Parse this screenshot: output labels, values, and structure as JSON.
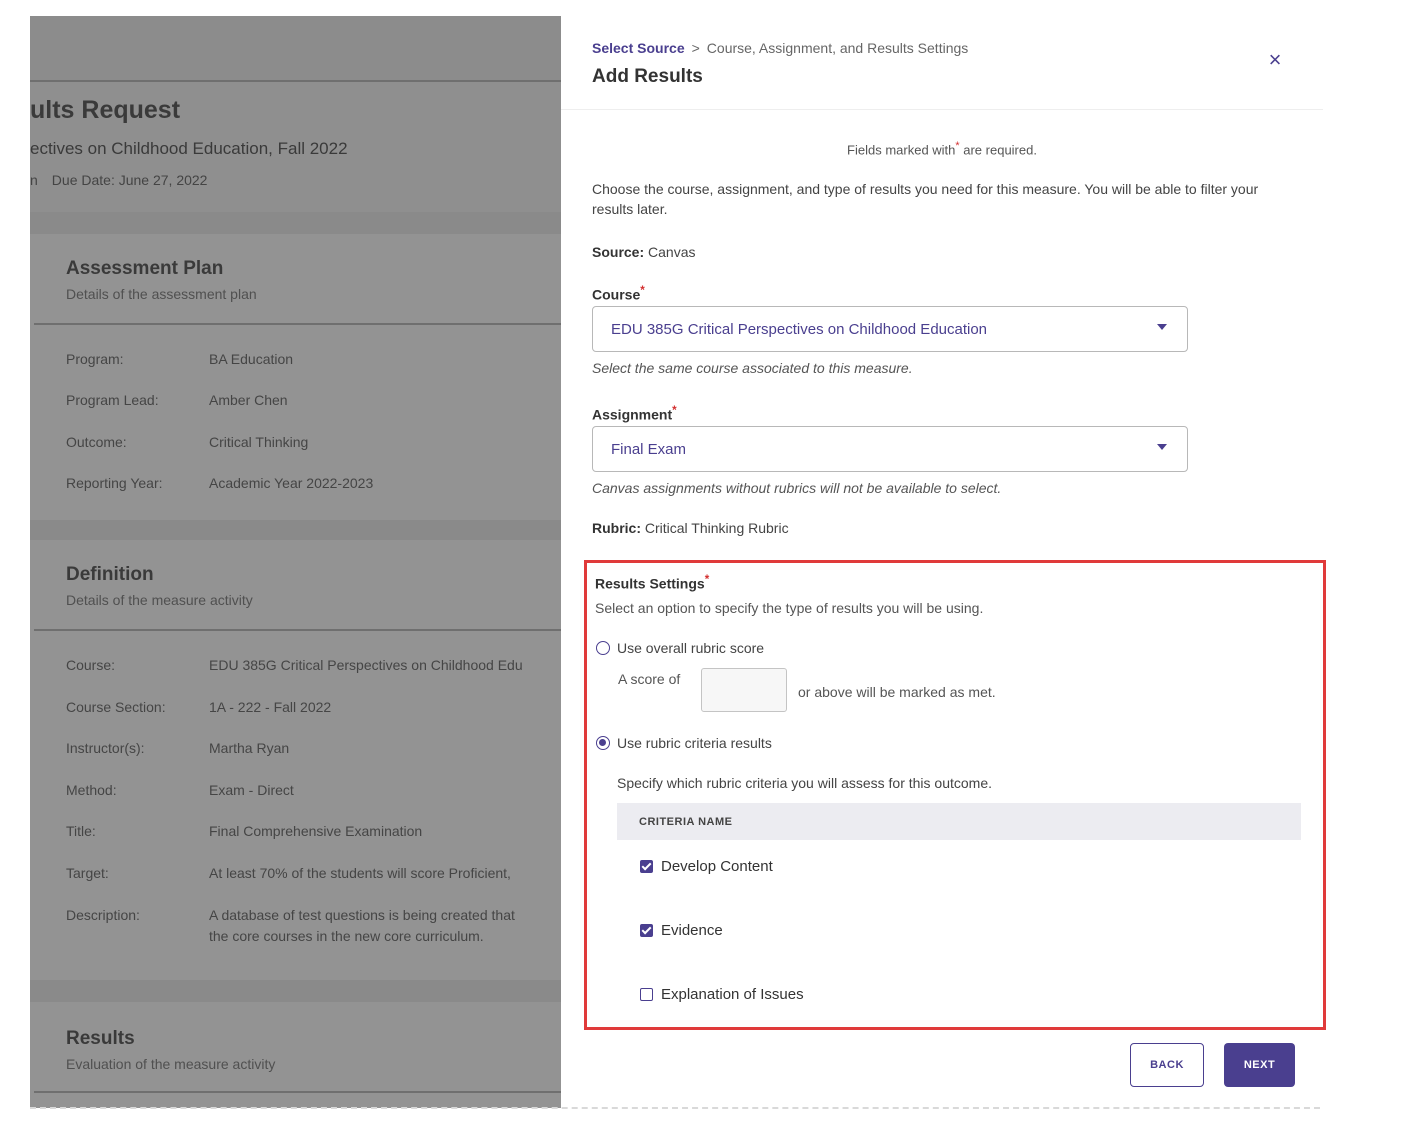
{
  "background": {
    "page_title": "ults Request",
    "subtitle": "ectives on Childhood Education, Fall 2022",
    "meta_prefix": "n",
    "due_date": "Due Date: June 27, 2022",
    "assessment_plan": {
      "title": "Assessment Plan",
      "description": "Details of the assessment plan",
      "rows": [
        {
          "key": "Program:",
          "value": "BA Education"
        },
        {
          "key": "Program Lead:",
          "value": "Amber Chen"
        },
        {
          "key": "Outcome:",
          "value": "Critical Thinking"
        },
        {
          "key": "Reporting Year:",
          "value": "Academic Year 2022-2023"
        }
      ]
    },
    "definition": {
      "title": "Definition",
      "description": "Details of the measure activity",
      "rows": [
        {
          "key": "Course:",
          "value": "EDU 385G Critical Perspectives on Childhood Edu"
        },
        {
          "key": "Course Section:",
          "value": "1A - 222 - Fall 2022"
        },
        {
          "key": "Instructor(s):",
          "value": "Martha Ryan"
        },
        {
          "key": "Method:",
          "value": "Exam - Direct"
        },
        {
          "key": "Title:",
          "value": "Final Comprehensive Examination"
        },
        {
          "key": "Target:",
          "value": "At least 70% of the students will score Proficient,"
        },
        {
          "key": "Description:",
          "value": "A database of test questions is being created that",
          "value2": "the core courses in the new core curriculum."
        }
      ]
    },
    "results": {
      "title": "Results",
      "description": "Evaluation of the measure activity"
    }
  },
  "modal": {
    "breadcrumb_link": "Select Source",
    "breadcrumb_separator": ">",
    "breadcrumb_current": "Course, Assignment, and Results Settings",
    "title": "Add Results",
    "close_icon": "×",
    "required_note_prefix": "Fields marked with",
    "required_note_suffix": "are required.",
    "required_star": "*",
    "intro": "Choose the course, assignment, and type of results you need for this measure. You will be able to filter your results later.",
    "source_label": "Source:",
    "source_value": "Canvas",
    "course": {
      "label": "Course",
      "value": "EDU 385G Critical Perspectives on Childhood Education",
      "helper": "Select the same course associated to this measure."
    },
    "assignment": {
      "label": "Assignment",
      "value": "Final Exam",
      "helper": "Canvas assignments without rubrics will not be available to select."
    },
    "rubric_label": "Rubric:",
    "rubric_value": "Critical Thinking Rubric",
    "results_settings": {
      "title": "Results Settings",
      "description": "Select an option to specify the type of results you will be using.",
      "option_overall": "Use overall rubric score",
      "option_overall_selected": false,
      "score_prefix": "A score of",
      "score_value": "",
      "score_suffix": "or above will be marked as met.",
      "option_criteria": "Use rubric criteria results",
      "option_criteria_selected": true,
      "specify_text": "Specify which rubric criteria you will assess for this outcome.",
      "table_header": "CRITERIA NAME",
      "criteria": [
        {
          "name": "Develop Content",
          "checked": true
        },
        {
          "name": "Evidence",
          "checked": true
        },
        {
          "name": "Explanation of Issues",
          "checked": false
        }
      ]
    },
    "back_label": "BACK",
    "next_label": "NEXT"
  },
  "colors": {
    "accent": "#4a3f8f",
    "required": "#d32f2f",
    "highlight_border": "#e03a3a",
    "overlay": "#8f8f8f"
  }
}
